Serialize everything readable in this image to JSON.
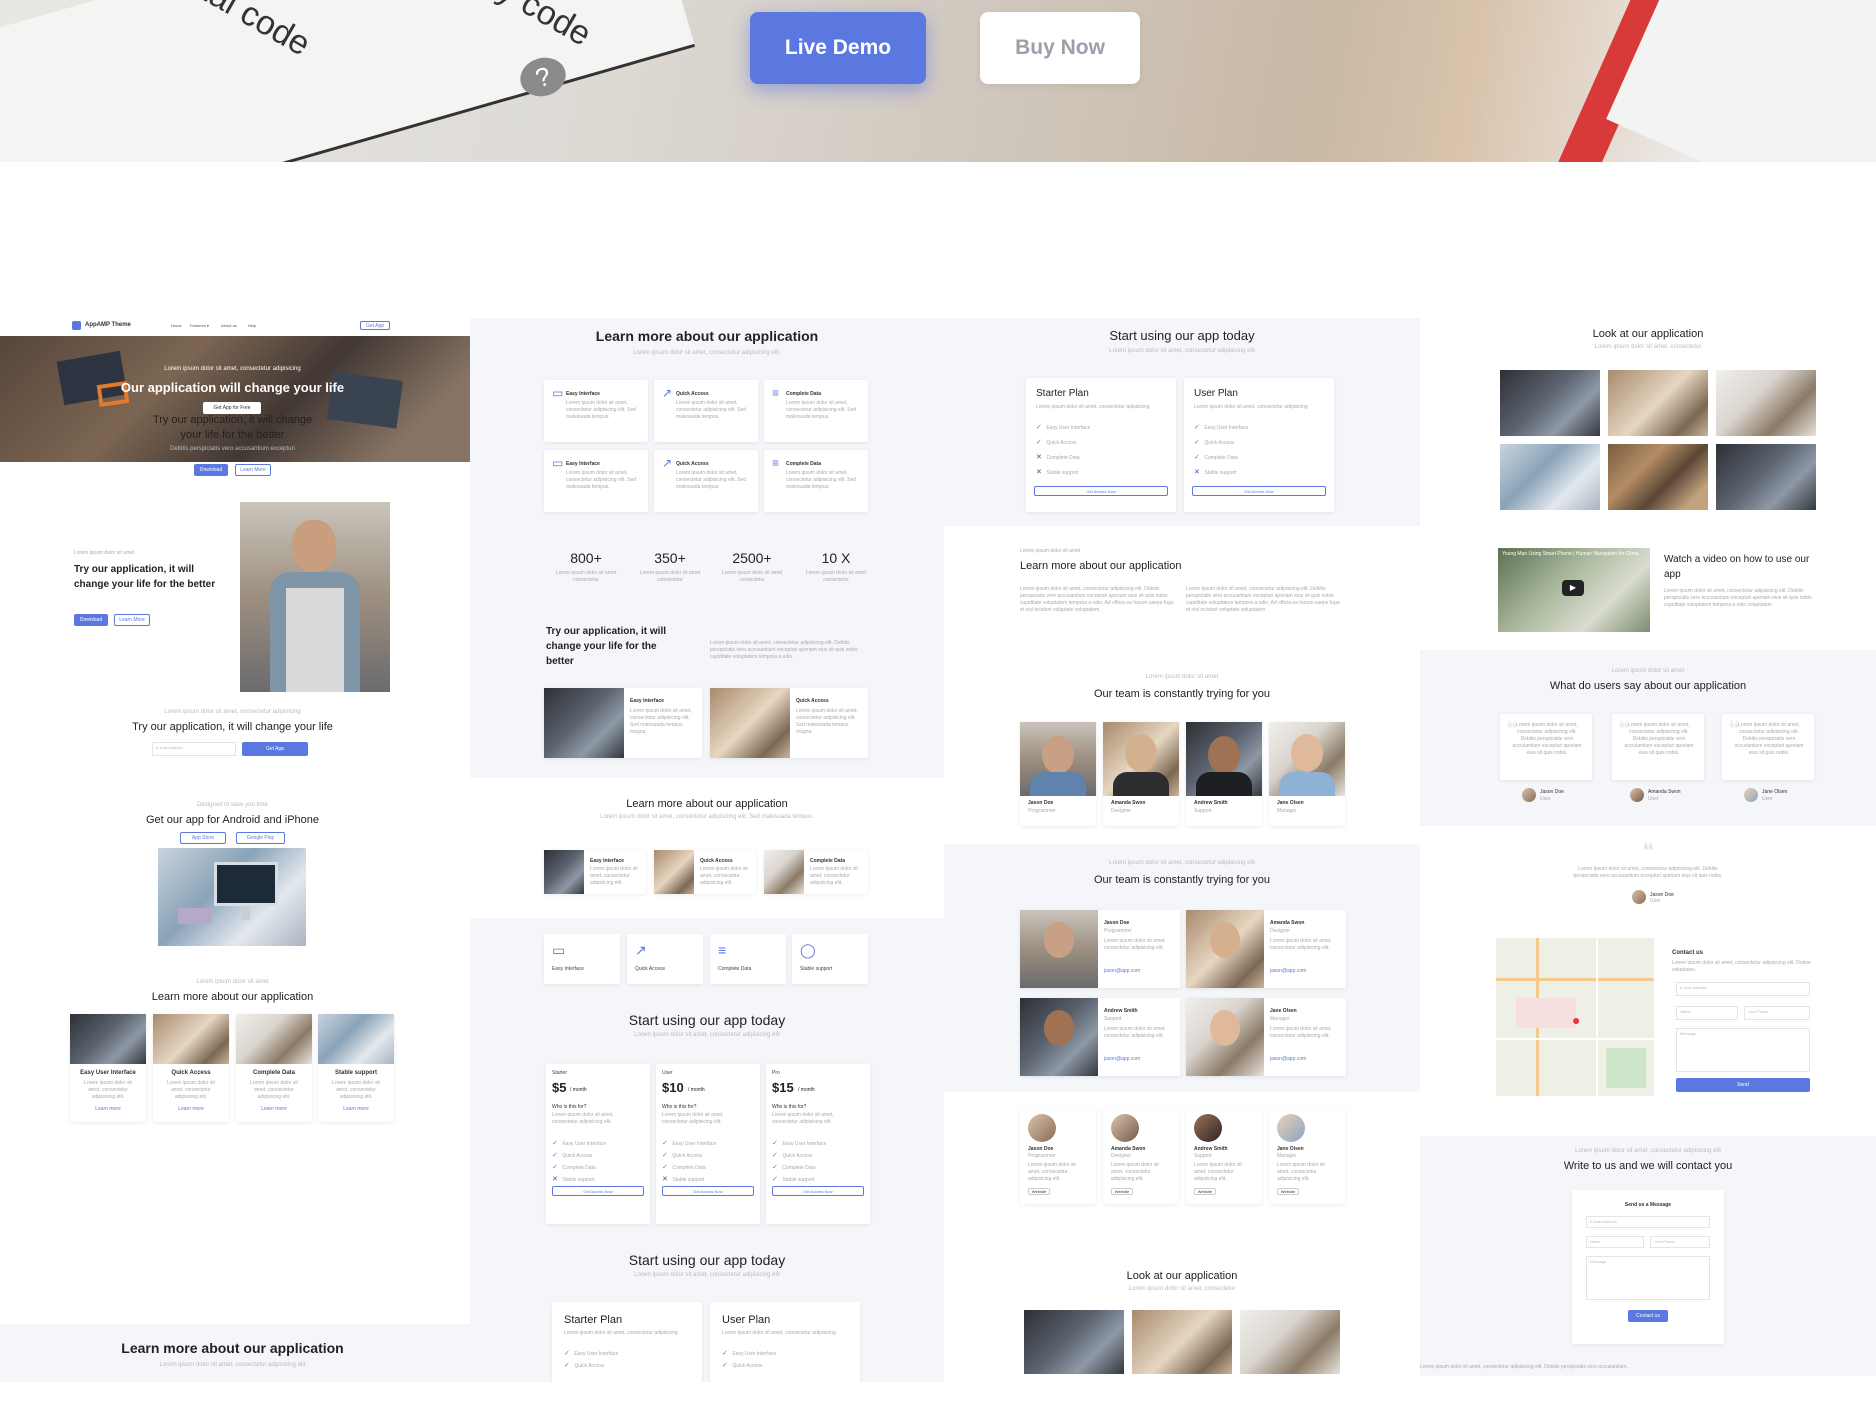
{
  "hero": {
    "live_demo": "Live Demo",
    "buy_now": "Buy Now",
    "paper_text_1": "ctal code",
    "paper_text_2": "rity code",
    "qmark": "?"
  },
  "col1": {
    "brand": "AppAMP Theme",
    "nav": [
      "Home",
      "Features ▾",
      "About us",
      "Help"
    ],
    "nav_btn": "Get App",
    "hero_small": "Lorem ipsum dolor sit amet, consectetur adipisicing",
    "hero_title": "Our application will change your life",
    "hero_btn": "Get App for Free",
    "s1_title_1": "Try our application, it will change",
    "s1_title_2": "your life for the better",
    "s1_sub": "Debitis perspiciatis vero accusantium excepturi",
    "s1_btn1": "Download",
    "s1_btn2": "Learn More",
    "s2_kicker": "Lorem ipsum dolor sit amet",
    "s2_title": "Try our application, it will change your life for the better",
    "s2_btn1": "Download",
    "s2_btn2": "Learn More",
    "s3_kicker": "Lorem ipsum dolor sit amet, consectetur adipisicing",
    "s3_title": "Try our application, it will change your life",
    "s3_input": "E-mail Address",
    "s3_btn": "Get App",
    "s4_kicker": "Designed to save you time",
    "s4_title": "Get our app for Android and iPhone",
    "s4_btn1": "App Store",
    "s4_btn2": "Google Play",
    "s5_kicker": "Lorem ipsum dolor sit amet",
    "s5_title": "Learn more about our application",
    "s5_cards": [
      "Easy User Interface",
      "Quick Access",
      "Complete Data",
      "Stable support"
    ],
    "s5_card_text": "Lorem ipsum dolor sit amet, consectetur adipisicing elit.",
    "s5_link": "Learn more",
    "s6_title": "Learn more about our application",
    "s6_sub": "Lorem ipsum dolor sit amet, consectetur adipisicing elit"
  },
  "col2": {
    "t1": "Learn more about our application",
    "t1_sub": "Lorem ipsum dolor sit amet, consectetur adipisicing elit.",
    "features": [
      "Easy Interface",
      "Quick Access",
      "Complete Data",
      "Easy Interface",
      "Quick Access",
      "Complete Data"
    ],
    "feature_text": "Lorem ipsum dolor sit amet, consectetur adipisicing elit. Sed malesuada tempus.",
    "stats": [
      "800+",
      "350+",
      "2500+",
      "10 X"
    ],
    "stat_text": "Lorem ipsum dolor sit amet consectetur",
    "t2": "Try our application, it will change your life for the better",
    "t2_text": "Lorem ipsum dolor sit amet, consectetur adipisicing elit. Debitis perspiciatis vero accusantium excepturi aperiam eius sit quis nobis cupiditate voluptatem tempora a odio.",
    "img_cards": [
      "Easy Interface",
      "Quick Access"
    ],
    "img_card_text": "Lorem ipsum dolor sit amet, consectetur adipisicing elit. Sed malesuada tempus magna.",
    "t3": "Learn more about our application",
    "t3_sub": "Lorem ipsum dolor sit amet, consectetur adipisicing elit. Sed malesuada tempus.",
    "row_cards": [
      "Easy Interface",
      "Quick Access",
      "Complete Data"
    ],
    "row_card_text": "Lorem ipsum dolor sit amet, consectetur adipisicing elit.",
    "icon_cards": [
      "Easy Interface",
      "Quick Access",
      "Complete Data",
      "Stable support"
    ],
    "t4": "Start using our app today",
    "t4_sub": "Lorem ipsum dolor sit amet, consectetur adipisicing elit",
    "plans": [
      {
        "name": "Starter",
        "price": "$5",
        "per": "/ month"
      },
      {
        "name": "User",
        "price": "$10",
        "per": "/ month"
      },
      {
        "name": "Pro",
        "price": "$15",
        "per": "/ month"
      }
    ],
    "plan_q": "Who is this for?",
    "plan_text": "Lorem ipsum dolor sit amet, consectetur adipisicing elit.",
    "plan_features": [
      "Easy User Interface",
      "Quick Access",
      "Complete Data",
      "Stable support"
    ],
    "plan_btn": "Get Access Now",
    "t5": "Start using our app today",
    "t5_sub": "Lorem ipsum dolor sit amet, consectetur adipisicing elit",
    "plans2": [
      "Starter Plan",
      "User Plan"
    ],
    "plans2_text": "Lorem ipsum dolor sit amet, consectetur adipisicing",
    "plans2_features": [
      "Easy User Interface",
      "Quick Access"
    ]
  },
  "col3": {
    "t1": "Start using our app today",
    "t1_sub": "Lorem ipsum dolor sit amet, consectetur adipisicing elit",
    "plans": [
      "Starter Plan",
      "User Plan"
    ],
    "plan_text": "Lorem ipsum dolor sit amet, consectetur adipisicing",
    "plan_features": [
      "Easy User Interface",
      "Quick Access",
      "Complete Data",
      "Stable support"
    ],
    "plan_btn": "Get Access Now",
    "t2_kicker": "Lorem ipsum dolor sit amet",
    "t2": "Learn more about our application",
    "t2_text": "Lorem ipsum dolor sit amet, consectetur adipisicing elit. Debitis perspiciatis vero accusantium excepturi aperiam eius sit quis nobis cupiditate voluptatem tempora a odio. Ad officia ea harum saepe fuga et nisl incidunt voluptate voluptatem.",
    "t3_kicker": "Lorem ipsum dolor sit amet",
    "t3": "Our team is constantly trying for you",
    "team": [
      {
        "name": "Jason Doe",
        "role": "Programmer"
      },
      {
        "name": "Amanda Swon",
        "role": "Designer"
      },
      {
        "name": "Andrew Smith",
        "role": "Support"
      },
      {
        "name": "Jane Olsen",
        "role": "Manager"
      }
    ],
    "t4_kicker": "Lorem ipsum dolor sit amet, consectetur adipisicing elit",
    "t4": "Our team is constantly trying for you",
    "team_text": "Lorem ipsum dolor sit amet, consectetur adipisicing elit.",
    "team_mail": "jason@app.com",
    "website": "Website",
    "t5": "Look at our application",
    "t5_sub": "Lorem ipsum dolor sit amet, consectetur"
  },
  "col4": {
    "t1": "Look at our application",
    "t1_sub": "Lorem ipsum dolor sit amet, consectetur",
    "video_caption": "Young Man Using Smart Phone | Human Navigation for Clima...",
    "video_title": "Watch a video on how to use our app",
    "video_text": "Lorem ipsum dolor sit amet, consectetur adipisicing elit. Debitis perspiciatis vero accusantium excepturi aperiam eius sit quis nobis cupiditate voluptatem tempora a odio voluptatem.",
    "t2_kicker": "Lorem ipsum dolor sit amet",
    "t2": "What do users say about our application",
    "quote_text": "Lorem ipsum dolor sit amet, consectetur adipisicing elit. Debitis perspiciatis vero accusantium excepturi aperiam eius sit quis nobis.",
    "quote_people": [
      "Jason Doe",
      "Amanda Swon",
      "Jane Olsen"
    ],
    "quote_roles": [
      "User",
      "User",
      "User"
    ],
    "single_quote": "Lorem ipsum dolor sit amet, consectetur adipisicing elit. Debitis perspiciatis vero accusantium excepturi aperiam eius sit quis nobis.",
    "single_person": "Jason Doe",
    "single_role": "User",
    "contact_title": "Contact us",
    "contact_text": "Lorem ipsum dolor sit amet, consectetur adipisicing elit. Dolore voluptates.",
    "contact_email": "E-mail address",
    "contact_name": "Name",
    "contact_phone": "Your Phone",
    "contact_message": "Message",
    "contact_send": "Send",
    "t3_kicker": "Lorem ipsum dolor sit amet, consectetur adipisicing elit",
    "t3": "Write to us and we will contact you",
    "form_title": "Send us a Message",
    "form_email": "E-mail Address",
    "form_name": "Name",
    "form_phone": "Your Phone",
    "form_message": "Message",
    "form_btn": "Contact us",
    "footer_text": "Lorem ipsum dolor sit amet, consectetur adipisicing elit. Debitis perspiciatis vero accusantium."
  },
  "colors": {
    "accent": "#5b78e0",
    "bg_alt": "#f5f6fa"
  }
}
